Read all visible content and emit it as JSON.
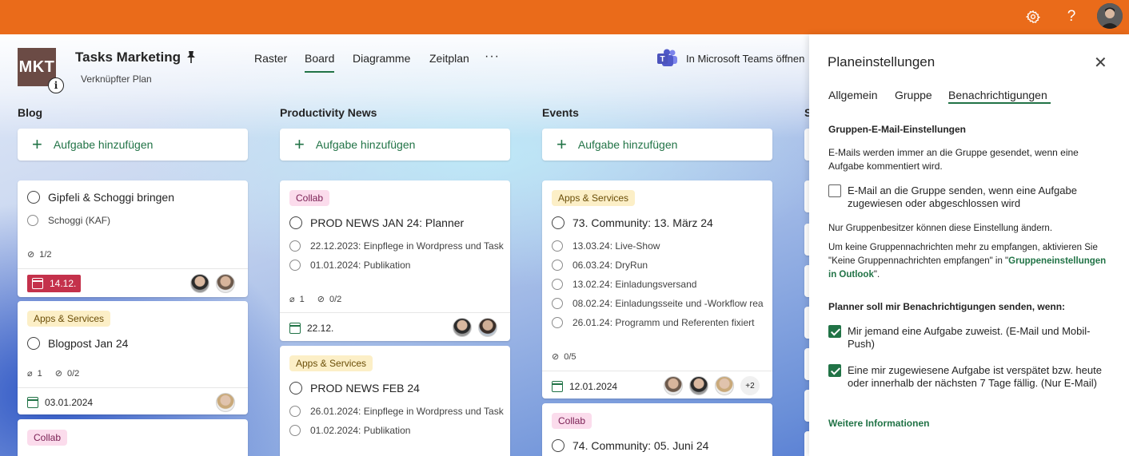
{
  "topbar": {
    "settings_icon": "gear-icon",
    "help_label": "?",
    "avatar_icon": "user-avatar"
  },
  "header": {
    "logo_text": "MKT",
    "info_label": "i",
    "title": "Tasks Marketing",
    "subtitle": "Verknüpfter Plan",
    "nav": [
      "Raster",
      "Board",
      "Diagramme",
      "Zeitplan"
    ],
    "active_nav": "Board",
    "more_label": "···",
    "teams_label": "In Microsoft Teams öffnen"
  },
  "columns": [
    {
      "title": "Blog",
      "add_label": "Aufgabe hinzufügen"
    },
    {
      "title": "Productivity News",
      "add_label": "Aufgabe hinzufügen"
    },
    {
      "title": "Events",
      "add_label": "Aufgabe hinzufügen"
    },
    {
      "title": "S"
    }
  ],
  "blog_cards": [
    {
      "title": "Gipfeli & Schoggi bringen",
      "subtasks": [
        "Schoggi (KAF)"
      ],
      "checklist": "1/2",
      "date": "14.12."
    },
    {
      "tag": "Apps & Services",
      "title": "Blogpost Jan 24",
      "attachments": "1",
      "checklist": "0/2",
      "date": "03.01.2024"
    },
    {
      "tag": "Collab"
    }
  ],
  "news_cards": [
    {
      "tag": "Collab",
      "title": "PROD NEWS JAN 24: Planner",
      "subtasks": [
        "22.12.2023: Einpflege in Wordpress und Task",
        "01.01.2024: Publikation"
      ],
      "attachments": "1",
      "checklist": "0/2",
      "date": "22.12."
    },
    {
      "tag": "Apps & Services",
      "title": "PROD NEWS FEB 24",
      "subtasks": [
        "26.01.2024: Einpflege in Wordpress und Task",
        "01.02.2024: Publikation"
      ]
    }
  ],
  "event_cards": [
    {
      "tag": "Apps & Services",
      "title": "73. Community: 13. März 24",
      "subtasks": [
        "13.03.24: Live-Show",
        "06.03.24: DryRun",
        "13.02.24: Einladungsversand",
        "08.02.24: Einladungsseite und -Workflow rea",
        "26.01.24: Programm und Referenten fixiert"
      ],
      "checklist": "0/5",
      "date": "12.01.2024",
      "more_assignees": "+2"
    },
    {
      "tag": "Collab",
      "title": "74. Community: 05. Juni 24"
    }
  ],
  "panel": {
    "title": "Planeinstellungen",
    "close_label": "✕",
    "tabs": [
      "Allgemein",
      "Gruppe",
      "Benachrichtigungen"
    ],
    "active_tab": "Benachrichtigungen",
    "group_heading": "Gruppen-E-Mail-Einstellungen",
    "group_text": "E-Mails werden immer an die Gruppe gesendet, wenn eine Aufgabe kommentiert wird.",
    "group_checkbox": "E-Mail an die Gruppe senden, wenn eine Aufgabe zugewiesen oder abgeschlossen wird",
    "owner_note": "Nur Gruppenbesitzer können diese Einstellung ändern.",
    "unsubscribe_prefix": "Um keine Gruppennachrichten mehr zu empfangen, aktivieren Sie \"Keine Gruppennachrichten empfangen\" in \"",
    "unsubscribe_link": "Gruppeneinstellungen in Outlook",
    "unsubscribe_suffix": "\".",
    "planner_heading": "Planner soll mir Benachrichtigungen senden, wenn:",
    "planner_opt1": "Mir jemand eine Aufgabe zuweist. (E-Mail und Mobil-Push)",
    "planner_opt2": "Eine mir zugewiesene Aufgabe ist verspätet bzw. heute oder innerhalb der nächsten 7 Tage fällig. (Nur E-Mail)",
    "more_info": "Weitere Informationen"
  },
  "colors": {
    "topbar": "#ea6b1a",
    "accent": "#217346",
    "overdue": "#c4314b"
  }
}
